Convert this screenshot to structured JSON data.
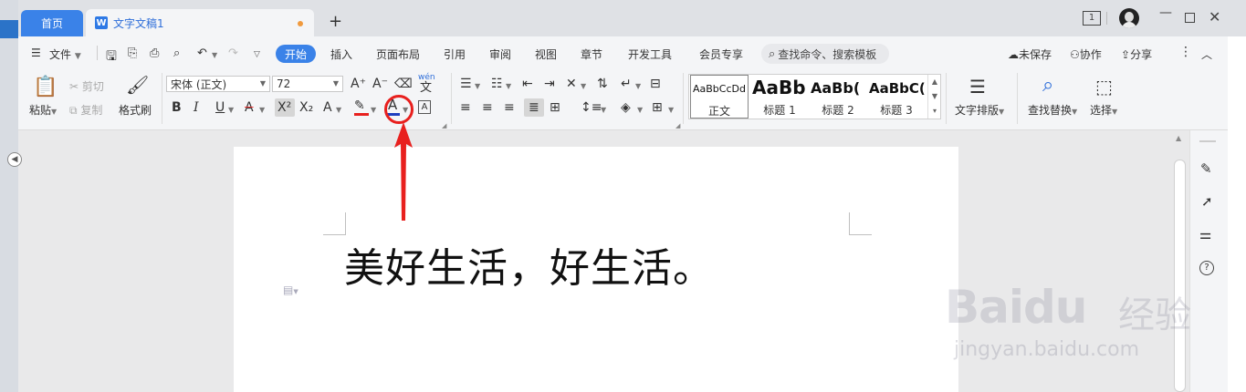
{
  "titlebar": {
    "home_tab": "首页",
    "doc_tab": "文字文稿1",
    "doc_icon": "W",
    "new_tab": "+",
    "page_count": "1"
  },
  "menu": {
    "file": "文件",
    "tabs": [
      "开始",
      "插入",
      "页面布局",
      "引用",
      "审阅",
      "视图",
      "章节",
      "开发工具",
      "会员专享"
    ],
    "search_placeholder": "查找命令、搜索模板",
    "unsaved": "未保存",
    "collab": "协作",
    "share": "分享"
  },
  "ribbon": {
    "paste": "粘贴",
    "cut": "剪切",
    "copy": "复制",
    "format_painter": "格式刷",
    "font_name": "宋体 (正文)",
    "font_size": "72",
    "pinyin": "wén",
    "styles": [
      {
        "sample": "AaBbCcDd",
        "name": "正文"
      },
      {
        "sample": "AaBb",
        "name": "标题 1"
      },
      {
        "sample": "AaBb(",
        "name": "标题 2"
      },
      {
        "sample": "AaBbC(",
        "name": "标题 3"
      }
    ],
    "text_layout": "文字排版",
    "find_replace": "查找替换",
    "select": "选择"
  },
  "document": {
    "text": "美好生活，好生活。"
  },
  "watermark": {
    "brand": "Baidu",
    "cn": "经验",
    "url": "jingyan.baidu.com"
  },
  "colors": {
    "accent": "#3a82e8",
    "highlight_red": "#e8201e",
    "font_color_blue": "#1f3fbf"
  }
}
